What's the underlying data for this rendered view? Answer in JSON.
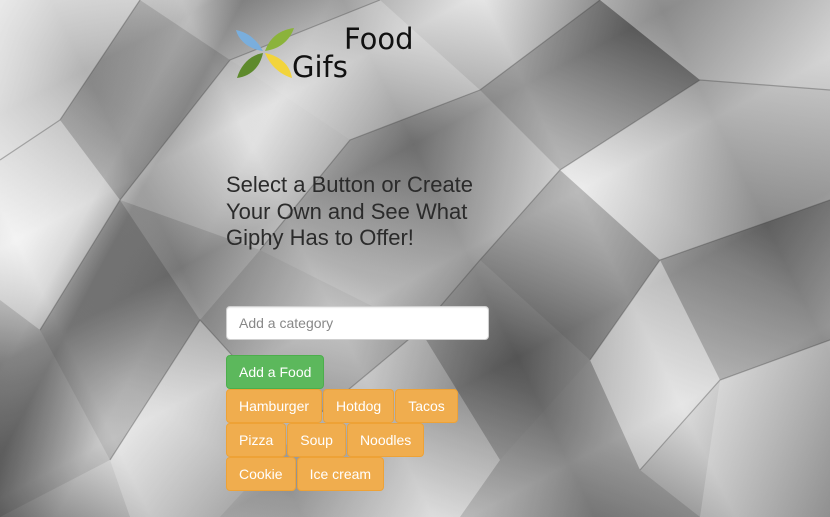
{
  "logo": {
    "word_top": "Food",
    "word_bottom": "Gifs",
    "leaf_colors": [
      "#7aaedc",
      "#8bb33b",
      "#5e8a2c",
      "#f2d43c"
    ]
  },
  "headline": "Select a Button or Create Your Own and See What Giphy Has to Offer!",
  "category_input": {
    "value": "",
    "placeholder": "Add a category"
  },
  "add_button": {
    "label": "Add a Food",
    "color": "#5cb85c"
  },
  "food_buttons": {
    "color": "#f0ad4e",
    "items": [
      {
        "label": "Hamburger"
      },
      {
        "label": "Hotdog"
      },
      {
        "label": "Tacos"
      },
      {
        "label": "Pizza"
      },
      {
        "label": "Soup"
      },
      {
        "label": "Noodles"
      },
      {
        "label": "Cookie"
      },
      {
        "label": "Ice cream"
      }
    ]
  }
}
